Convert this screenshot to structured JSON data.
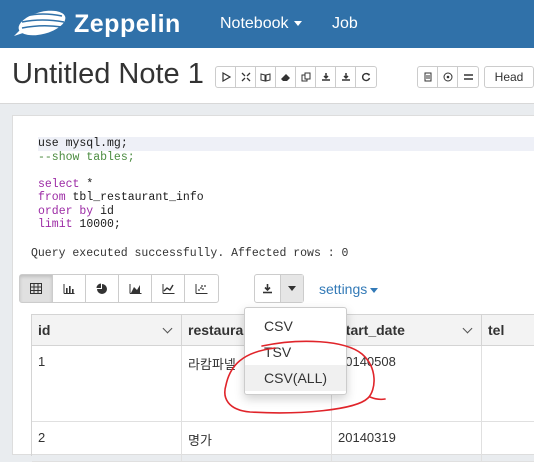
{
  "navbar": {
    "brand": "Zeppelin",
    "menu": [
      {
        "label": "Notebook",
        "has_caret": true
      },
      {
        "label": "Job",
        "has_caret": false
      }
    ],
    "background": "#3071a9"
  },
  "note": {
    "title": "Untitled Note 1",
    "toolbar_group1_icons": [
      "play-icon",
      "collapse-icon",
      "book-icon",
      "eraser-icon",
      "copy-icon",
      "export-icon",
      "export-alt-icon",
      "refresh-icon"
    ],
    "toolbar_group2_icons": [
      "clone-icon",
      "clock-icon",
      "swap-icon"
    ],
    "head_label": "Head"
  },
  "paragraph": {
    "code_lines": [
      [
        {
          "t": "use mysql.mg;",
          "c": "tx"
        }
      ],
      [
        {
          "t": "--show tables;",
          "c": "cm"
        }
      ],
      [
        {
          "t": " ",
          "c": "tx"
        }
      ],
      [
        {
          "t": "select",
          "c": "kw"
        },
        {
          "t": " *",
          "c": "tx"
        }
      ],
      [
        {
          "t": "from",
          "c": "kw"
        },
        {
          "t": " tbl_restaurant_info",
          "c": "tx"
        }
      ],
      [
        {
          "t": "order by",
          "c": "kw"
        },
        {
          "t": " id",
          "c": "tx"
        }
      ],
      [
        {
          "t": "limit",
          "c": "kw"
        },
        {
          "t": " 10000;",
          "c": "tx"
        }
      ]
    ],
    "result_message": "Query executed successfully. Affected rows : 0",
    "settings_label": "settings",
    "viz_buttons": [
      "table-icon",
      "bar-chart-icon",
      "pie-chart-icon",
      "area-chart-icon",
      "line-chart-icon",
      "scatter-chart-icon"
    ]
  },
  "table": {
    "columns": [
      "id",
      "restaurant",
      "start_date",
      "tel"
    ],
    "rows": [
      [
        "1",
        "라캄파넬",
        "20140508",
        ""
      ],
      [
        "2",
        "명가",
        "20140319",
        ""
      ]
    ]
  },
  "download_menu": {
    "items": [
      "CSV",
      "TSV",
      "CSV(ALL)"
    ],
    "highlighted_index": 2
  },
  "annotation_color": "#e0242a"
}
